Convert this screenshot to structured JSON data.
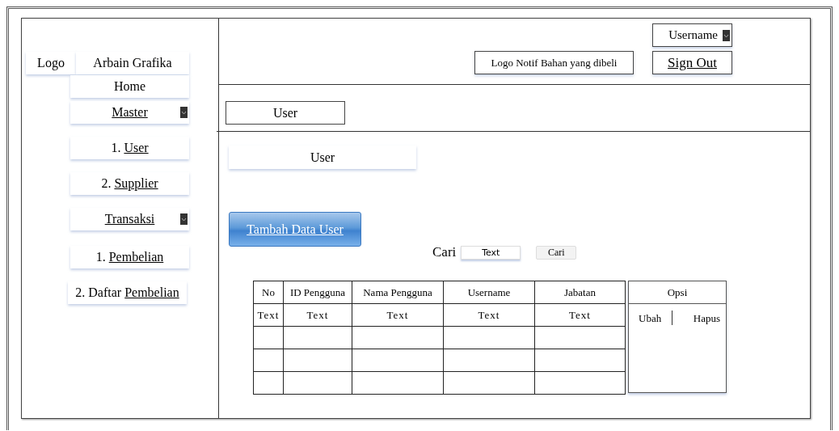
{
  "sidebar": {
    "logo": "Logo",
    "brand": "Arbain Grafika",
    "items": [
      {
        "kind": "plain",
        "label": "Home"
      },
      {
        "kind": "dropdown",
        "label": "Master"
      },
      {
        "kind": "sub",
        "number": "1.",
        "label": "User"
      },
      {
        "kind": "sub",
        "number": "2.",
        "label": "Supplier"
      },
      {
        "kind": "dropdown",
        "label": "Transaksi"
      },
      {
        "kind": "sub",
        "number": "1.",
        "label": "Pembelian"
      },
      {
        "kind": "sub",
        "number": "2.",
        "prefix": "Daftar",
        "label": "Pembelian"
      }
    ]
  },
  "header": {
    "user_menu": "Username",
    "notification": "Logo Notif Bahan yang dibeli",
    "sign_out": "Sign Out"
  },
  "breadcrumb": "User",
  "page_title": "User",
  "add_button": "Tambah Data User",
  "search": {
    "label": "Cari",
    "value": "Text",
    "button": "Cari"
  },
  "table": {
    "columns": [
      "No",
      "ID Pengguna",
      "Nama Pengguna",
      "Username",
      "Jabatan"
    ],
    "rows": [
      {
        "cells": [
          "Text",
          "Text",
          "Text",
          "Text",
          "Text"
        ]
      },
      {
        "blank": true
      },
      {
        "blank": true
      },
      {
        "blank": true
      }
    ]
  },
  "options": {
    "title": "Opsi",
    "actions": [
      "Ubah",
      "Hapus"
    ]
  }
}
